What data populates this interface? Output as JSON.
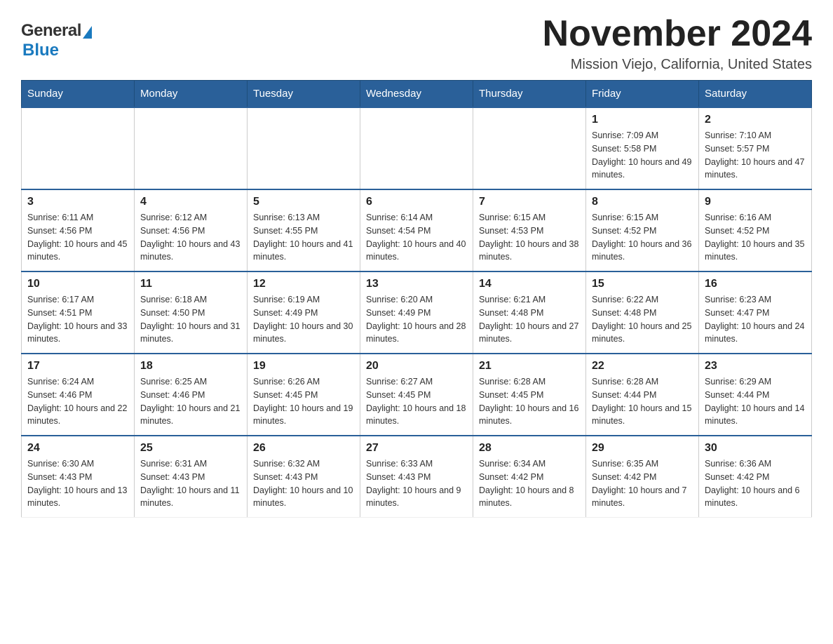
{
  "header": {
    "logo_general": "General",
    "logo_blue": "Blue",
    "title": "November 2024",
    "subtitle": "Mission Viejo, California, United States"
  },
  "weekdays": [
    "Sunday",
    "Monday",
    "Tuesday",
    "Wednesday",
    "Thursday",
    "Friday",
    "Saturday"
  ],
  "weeks": [
    [
      {
        "day": "",
        "info": ""
      },
      {
        "day": "",
        "info": ""
      },
      {
        "day": "",
        "info": ""
      },
      {
        "day": "",
        "info": ""
      },
      {
        "day": "",
        "info": ""
      },
      {
        "day": "1",
        "info": "Sunrise: 7:09 AM\nSunset: 5:58 PM\nDaylight: 10 hours and 49 minutes."
      },
      {
        "day": "2",
        "info": "Sunrise: 7:10 AM\nSunset: 5:57 PM\nDaylight: 10 hours and 47 minutes."
      }
    ],
    [
      {
        "day": "3",
        "info": "Sunrise: 6:11 AM\nSunset: 4:56 PM\nDaylight: 10 hours and 45 minutes."
      },
      {
        "day": "4",
        "info": "Sunrise: 6:12 AM\nSunset: 4:56 PM\nDaylight: 10 hours and 43 minutes."
      },
      {
        "day": "5",
        "info": "Sunrise: 6:13 AM\nSunset: 4:55 PM\nDaylight: 10 hours and 41 minutes."
      },
      {
        "day": "6",
        "info": "Sunrise: 6:14 AM\nSunset: 4:54 PM\nDaylight: 10 hours and 40 minutes."
      },
      {
        "day": "7",
        "info": "Sunrise: 6:15 AM\nSunset: 4:53 PM\nDaylight: 10 hours and 38 minutes."
      },
      {
        "day": "8",
        "info": "Sunrise: 6:15 AM\nSunset: 4:52 PM\nDaylight: 10 hours and 36 minutes."
      },
      {
        "day": "9",
        "info": "Sunrise: 6:16 AM\nSunset: 4:52 PM\nDaylight: 10 hours and 35 minutes."
      }
    ],
    [
      {
        "day": "10",
        "info": "Sunrise: 6:17 AM\nSunset: 4:51 PM\nDaylight: 10 hours and 33 minutes."
      },
      {
        "day": "11",
        "info": "Sunrise: 6:18 AM\nSunset: 4:50 PM\nDaylight: 10 hours and 31 minutes."
      },
      {
        "day": "12",
        "info": "Sunrise: 6:19 AM\nSunset: 4:49 PM\nDaylight: 10 hours and 30 minutes."
      },
      {
        "day": "13",
        "info": "Sunrise: 6:20 AM\nSunset: 4:49 PM\nDaylight: 10 hours and 28 minutes."
      },
      {
        "day": "14",
        "info": "Sunrise: 6:21 AM\nSunset: 4:48 PM\nDaylight: 10 hours and 27 minutes."
      },
      {
        "day": "15",
        "info": "Sunrise: 6:22 AM\nSunset: 4:48 PM\nDaylight: 10 hours and 25 minutes."
      },
      {
        "day": "16",
        "info": "Sunrise: 6:23 AM\nSunset: 4:47 PM\nDaylight: 10 hours and 24 minutes."
      }
    ],
    [
      {
        "day": "17",
        "info": "Sunrise: 6:24 AM\nSunset: 4:46 PM\nDaylight: 10 hours and 22 minutes."
      },
      {
        "day": "18",
        "info": "Sunrise: 6:25 AM\nSunset: 4:46 PM\nDaylight: 10 hours and 21 minutes."
      },
      {
        "day": "19",
        "info": "Sunrise: 6:26 AM\nSunset: 4:45 PM\nDaylight: 10 hours and 19 minutes."
      },
      {
        "day": "20",
        "info": "Sunrise: 6:27 AM\nSunset: 4:45 PM\nDaylight: 10 hours and 18 minutes."
      },
      {
        "day": "21",
        "info": "Sunrise: 6:28 AM\nSunset: 4:45 PM\nDaylight: 10 hours and 16 minutes."
      },
      {
        "day": "22",
        "info": "Sunrise: 6:28 AM\nSunset: 4:44 PM\nDaylight: 10 hours and 15 minutes."
      },
      {
        "day": "23",
        "info": "Sunrise: 6:29 AM\nSunset: 4:44 PM\nDaylight: 10 hours and 14 minutes."
      }
    ],
    [
      {
        "day": "24",
        "info": "Sunrise: 6:30 AM\nSunset: 4:43 PM\nDaylight: 10 hours and 13 minutes."
      },
      {
        "day": "25",
        "info": "Sunrise: 6:31 AM\nSunset: 4:43 PM\nDaylight: 10 hours and 11 minutes."
      },
      {
        "day": "26",
        "info": "Sunrise: 6:32 AM\nSunset: 4:43 PM\nDaylight: 10 hours and 10 minutes."
      },
      {
        "day": "27",
        "info": "Sunrise: 6:33 AM\nSunset: 4:43 PM\nDaylight: 10 hours and 9 minutes."
      },
      {
        "day": "28",
        "info": "Sunrise: 6:34 AM\nSunset: 4:42 PM\nDaylight: 10 hours and 8 minutes."
      },
      {
        "day": "29",
        "info": "Sunrise: 6:35 AM\nSunset: 4:42 PM\nDaylight: 10 hours and 7 minutes."
      },
      {
        "day": "30",
        "info": "Sunrise: 6:36 AM\nSunset: 4:42 PM\nDaylight: 10 hours and 6 minutes."
      }
    ]
  ]
}
